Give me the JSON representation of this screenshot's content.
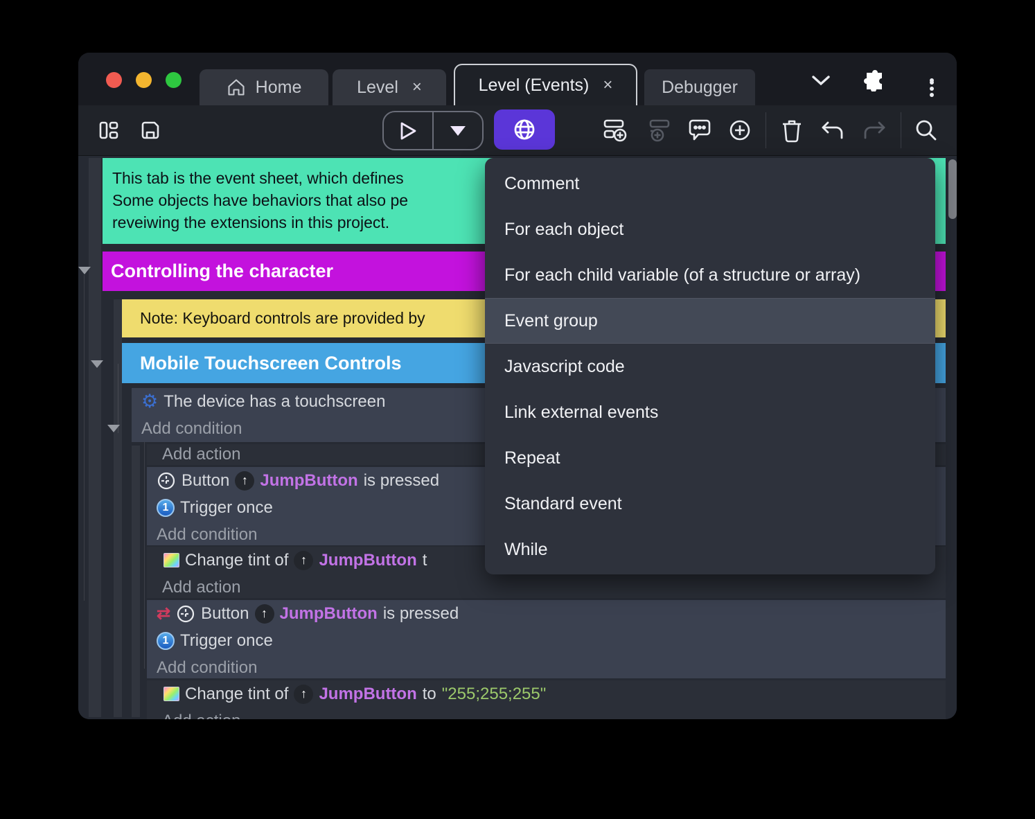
{
  "titlebar": {
    "tabs": [
      {
        "label": "Home"
      },
      {
        "label": "Level",
        "close": "×"
      },
      {
        "label": "Level (Events)",
        "close": "×"
      },
      {
        "label": "Debugger"
      }
    ]
  },
  "menu": {
    "items": [
      "Comment",
      "For each object",
      "For each child variable (of a structure or array)",
      "Event group",
      "Javascript code",
      "Link external events",
      "Repeat",
      "Standard event",
      "While"
    ],
    "highlighted_item": "Event group"
  },
  "sheet": {
    "comment": {
      "line1": "This tab is the event sheet, which defines",
      "line2": "Some objects have behaviors that also pe",
      "line3": "reveiwing the extensions in this project."
    },
    "group_controlling": "Controlling the character",
    "note": "Note: Keyboard controls are provided by",
    "group_mobile": "Mobile Touchscreen Controls",
    "labels": {
      "add_condition": "Add condition",
      "add_action": "Add action",
      "trigger_once": "Trigger once"
    },
    "touch_event": {
      "condition": "The device has a touchscreen"
    },
    "button_event": {
      "prefix": "Button",
      "object": "JumpButton",
      "suffix": "is pressed"
    },
    "object_badge_arrow": "↑",
    "trigger_once_glyph": "1",
    "invert_glyph": "⇄",
    "gear_glyph": "⚙",
    "tint_action_partial": {
      "prefix": "Change tint of",
      "object": "JumpButton",
      "suffix": "t"
    },
    "tint_action_full": {
      "prefix": "Change tint of",
      "object": "JumpButton",
      "to": "to",
      "value": "\"255;255;255\""
    }
  },
  "colors": {
    "accent_purple": "#5b36d8",
    "comment_teal": "#4de3b4",
    "group_magenta": "#c312dd",
    "note_yellow": "#efdc6e",
    "group_blue": "#45a5e2",
    "object_text": "#c273e6",
    "string_text": "#9cc96b"
  }
}
